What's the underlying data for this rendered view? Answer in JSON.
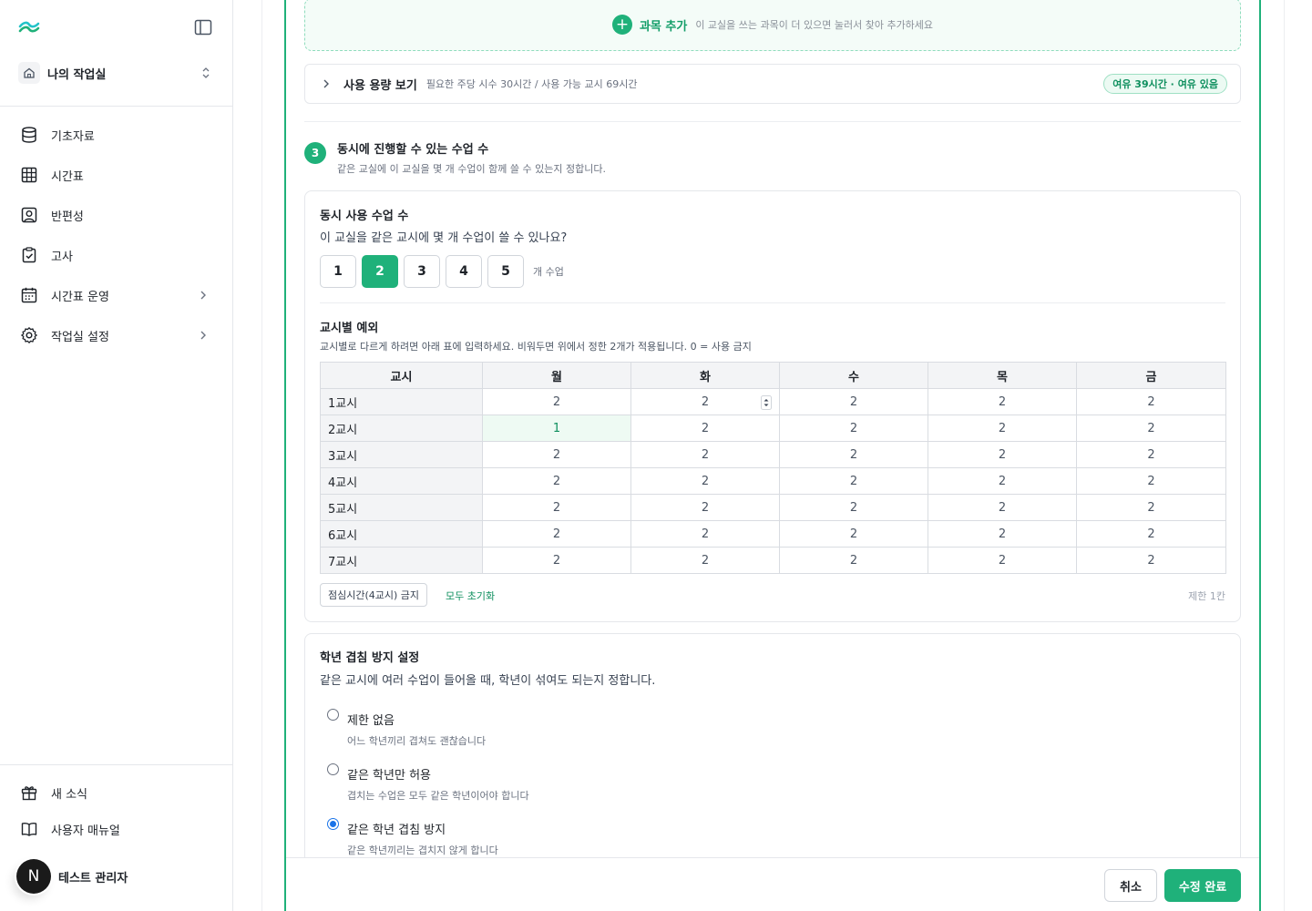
{
  "sidebar": {
    "workspace": {
      "name": "나의 작업실",
      "icon": "home-icon"
    },
    "items": [
      {
        "label": "기초자료",
        "icon": "database-icon"
      },
      {
        "label": "시간표",
        "icon": "grid-table-icon"
      },
      {
        "label": "반편성",
        "icon": "person-badge-icon"
      },
      {
        "label": "고사",
        "icon": "clipboard-check-icon"
      },
      {
        "label": "시간표 운영",
        "icon": "calendar-icon",
        "has_submenu": true
      },
      {
        "label": "작업실 설정",
        "icon": "gear-icon",
        "has_submenu": true
      }
    ],
    "bottom_items": [
      {
        "label": "새 소식",
        "icon": "gift-icon"
      },
      {
        "label": "사용자 매뉴얼",
        "icon": "book-icon"
      }
    ],
    "user": {
      "initial": "N",
      "name": "테스트 관리자"
    }
  },
  "add_subject": {
    "label": "과목 추가",
    "hint": "이 교실을 쓰는 과목이 더 있으면 눌러서 찾아 추가하세요"
  },
  "usage": {
    "title": "사용 용량 보기",
    "description": "필요한 주당 시수 30시간 / 사용 가능 교시 69시간",
    "badge": "여유 39시간 · 여유 있음"
  },
  "step": {
    "number": "3",
    "title": "동시에 진행할 수 있는 수업 수",
    "description": "같은 교실에 이 교실을 몇 개 수업이 함께 쓸 수 있는지 정합니다."
  },
  "concurrent": {
    "title": "동시 사용 수업 수",
    "question": "이 교실을 같은 교시에 몇 개 수업이 쓸 수 있나요?",
    "options": [
      "1",
      "2",
      "3",
      "4",
      "5"
    ],
    "selected": "2",
    "unit": "개 수업"
  },
  "exceptions": {
    "title": "교시별 예외",
    "description": "교시별로 다르게 하려면 아래 표에 입력하세요. 비워두면 위에서 정한 2개가 적용됩니다. 0 = 사용 금지",
    "headers": [
      "교시",
      "월",
      "화",
      "수",
      "목",
      "금"
    ],
    "rows": [
      {
        "period": "1교시",
        "values": [
          "2",
          "2",
          "2",
          "2",
          "2"
        ]
      },
      {
        "period": "2교시",
        "values": [
          "1",
          "2",
          "2",
          "2",
          "2"
        ]
      },
      {
        "period": "3교시",
        "values": [
          "2",
          "2",
          "2",
          "2",
          "2"
        ]
      },
      {
        "period": "4교시",
        "values": [
          "2",
          "2",
          "2",
          "2",
          "2"
        ]
      },
      {
        "period": "5교시",
        "values": [
          "2",
          "2",
          "2",
          "2",
          "2"
        ]
      },
      {
        "period": "6교시",
        "values": [
          "2",
          "2",
          "2",
          "2",
          "2"
        ]
      },
      {
        "period": "7교시",
        "values": [
          "2",
          "2",
          "2",
          "2",
          "2"
        ]
      }
    ],
    "lunch_button": "점심시간(4교시) 금지",
    "reset_link": "모두 초기화",
    "limit_note": "제한 1칸"
  },
  "grade_overlap": {
    "title": "학년 겹침 방지 설정",
    "description": "같은 교시에 여러 수업이 들어올 때, 학년이 섞여도 되는지 정합니다.",
    "options": [
      {
        "label": "제한 없음",
        "desc": "어느 학년끼리 겹쳐도 괜찮습니다"
      },
      {
        "label": "같은 학년만 허용",
        "desc": "겹치는 수업은 모두 같은 학년이어야 합니다"
      },
      {
        "label": "같은 학년 겹침 방지",
        "desc": "같은 학년끼리는 겹치지 않게 합니다"
      }
    ],
    "selected_index": 2
  },
  "footer": {
    "cancel": "취소",
    "save": "수정 완료"
  },
  "colors": {
    "accent": "#1fb17a",
    "accent_dark": "#0e8f5e",
    "radio_blue": "#1a73e8"
  }
}
